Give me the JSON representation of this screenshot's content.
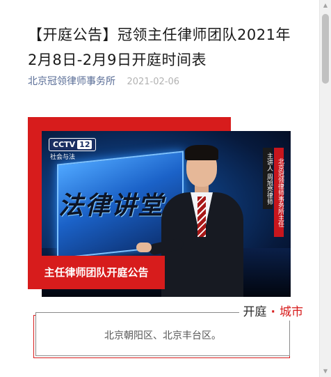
{
  "article": {
    "title": "【开庭公告】冠领主任律师团队2021年2月8日-2月9日开庭时间表",
    "author": "北京冠领律师事务所",
    "date": "2021-02-06"
  },
  "cover": {
    "logo_text": "CCTV",
    "logo_num": "12",
    "channel_text": "社会与法",
    "calligraphy": "法律讲堂",
    "caption_main": "北京冠领律师事务所主任",
    "caption_sub": "主讲人 周旭亮律师",
    "red_tag": "主任律师团队开庭公告"
  },
  "card": {
    "header_left": "开庭",
    "header_dot": "·",
    "header_right": "城市",
    "text": "北京朝阳区、北京丰台区。"
  },
  "scrollbar": {
    "up_icon": "▲",
    "down_icon": "▼"
  },
  "colors": {
    "accent_red": "#d71c1c",
    "link_blue": "#576b95",
    "date_gray": "#b2b2b2"
  }
}
